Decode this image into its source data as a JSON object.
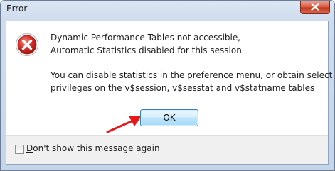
{
  "window": {
    "title": "Error"
  },
  "message": {
    "line1": "Dynamic Performance Tables not accessible,",
    "line2": "Automatic Statistics disabled for this session",
    "line3": "You can disable statistics in the preference menu, or obtain select",
    "line4": "privileges on the v$session, v$sesstat and v$statname tables"
  },
  "buttons": {
    "ok_label": "OK"
  },
  "checkbox": {
    "label_underlined": "D",
    "label_rest": "on't show this message again",
    "checked": false
  },
  "icons": {
    "error": "error-icon",
    "close": "close-icon",
    "annotation_arrow": "arrow-icon"
  },
  "colors": {
    "error_red": "#d9302a",
    "arrow_red": "#e8191d",
    "ok_border": "#3c7fb1"
  }
}
